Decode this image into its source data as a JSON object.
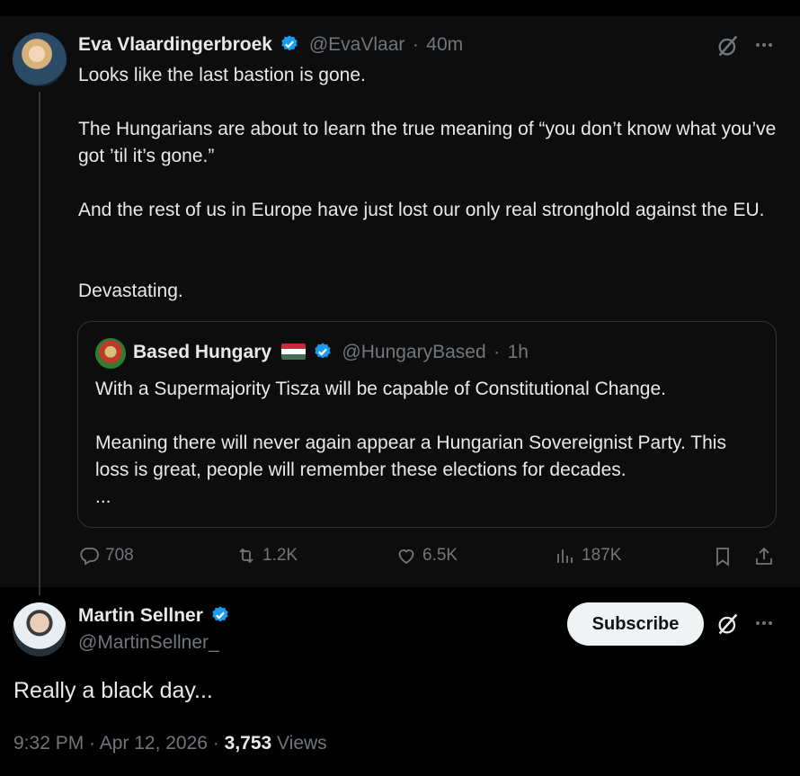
{
  "parent_post": {
    "author_name": "Eva Vlaardingerbroek",
    "handle": "@EvaVlaar",
    "separator": "·",
    "time": "40m",
    "paragraphs": [
      "Looks like the last bastion is gone.",
      "The Hungarians are about to learn the true meaning of “you don’t know what you’ve got ’til it’s gone.”",
      "And the rest of us in Europe have just lost our only real stronghold against the EU.",
      "Devastating."
    ],
    "quote": {
      "author_name": "Based Hungary",
      "handle": "@HungaryBased",
      "separator": "·",
      "time": "1h",
      "paragraphs": [
        "With a Supermajority Tisza will be capable of Constitutional Change.",
        "Meaning there will never again appear a Hungarian Sovereignist Party. This loss is great, people will remember these elections for decades.",
        "..."
      ]
    },
    "actions": {
      "replies": "708",
      "reposts": "1.2K",
      "likes": "6.5K",
      "views": "187K"
    }
  },
  "main_post": {
    "author_name": "Martin Sellner",
    "handle": "@MartinSellner_",
    "subscribe_label": "Subscribe",
    "text": "Really a black day...",
    "timestamp": "9:32 PM · Apr 12, 2026 ·",
    "views_count": "3,753",
    "views_label": "Views"
  },
  "colors": {
    "background": "#000000",
    "parent_background": "#0d0d0d",
    "text": "#e7e9ea",
    "muted": "#71767b",
    "verified_blue": "#1d9bf0",
    "border": "#2f3336"
  },
  "icons": [
    "grok-icon",
    "more-icon",
    "verified-badge-icon",
    "hungary-flag-icon",
    "reply-icon",
    "repost-icon",
    "like-icon",
    "views-icon",
    "bookmark-icon",
    "share-icon"
  ]
}
